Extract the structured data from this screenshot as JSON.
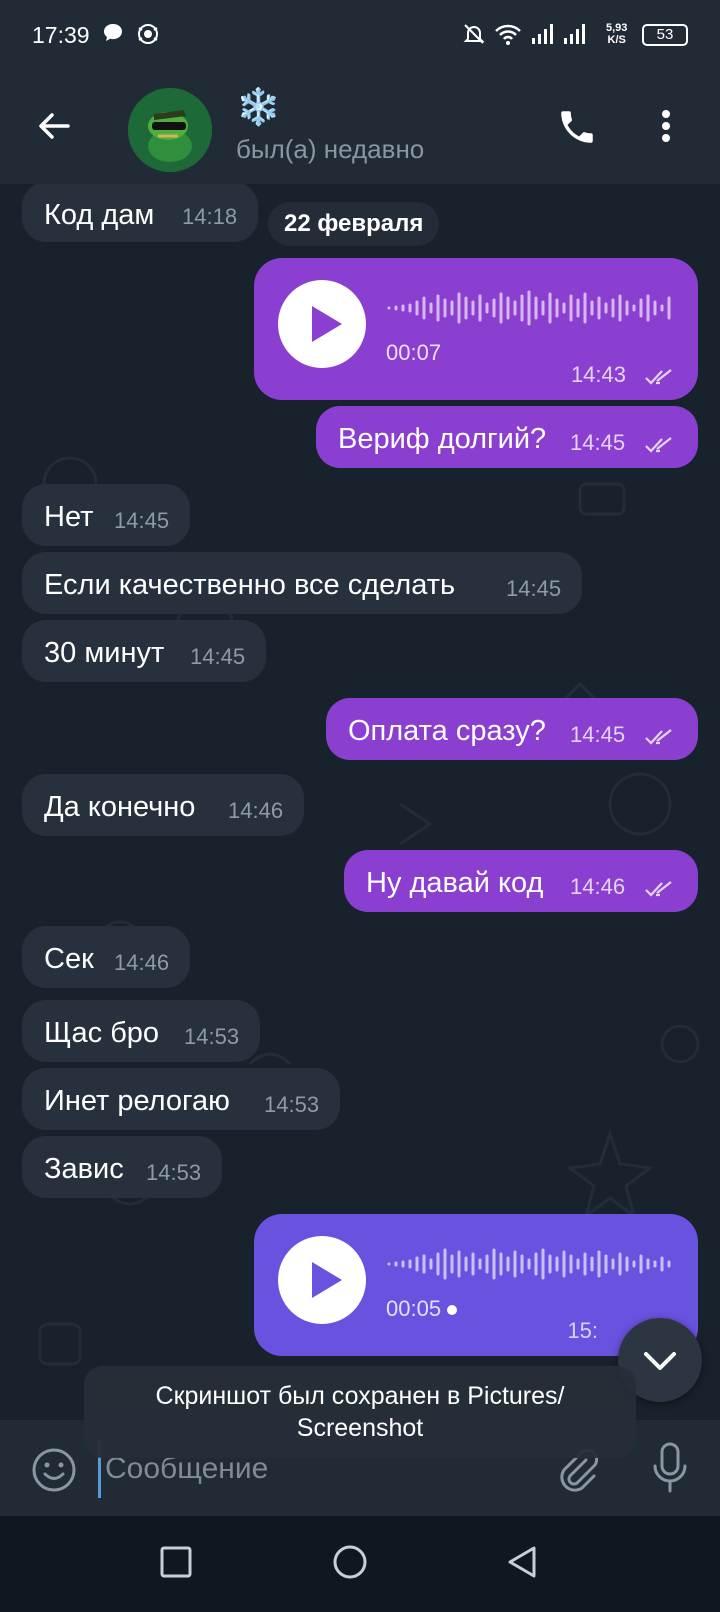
{
  "status_bar": {
    "time": "17:39",
    "net_speed_top": "5,93",
    "net_speed_bottom": "K/S",
    "battery": "53"
  },
  "header": {
    "name": "❄️",
    "status": "был(а) недавно",
    "icons": [
      "back-arrow-icon",
      "avatar",
      "phone-icon",
      "more-vertical-icon"
    ]
  },
  "chat": {
    "date_separator": "22 февраля",
    "messages": [
      {
        "dir": "in",
        "text": "Код дам",
        "time": "14:18"
      },
      {
        "dir": "out",
        "type": "voice",
        "duration": "00:07",
        "time": "14:43"
      },
      {
        "dir": "out",
        "text": "Вериф долгий?",
        "time": "14:45"
      },
      {
        "dir": "in",
        "text": "Нет",
        "time": "14:45"
      },
      {
        "dir": "in",
        "text": "Если качественно все сделать",
        "time": "14:45"
      },
      {
        "dir": "in",
        "text": "30 минут",
        "time": "14:45"
      },
      {
        "dir": "out",
        "text": "Оплата сразу?",
        "time": "14:45"
      },
      {
        "dir": "in",
        "text": "Да конечно",
        "time": "14:46"
      },
      {
        "dir": "out",
        "text": "Ну давай код",
        "time": "14:46"
      },
      {
        "dir": "in",
        "text": "Сек",
        "time": "14:46"
      },
      {
        "dir": "in",
        "text": "Щас бро",
        "time": "14:53"
      },
      {
        "dir": "in",
        "text": "Инет релогаю",
        "time": "14:53"
      },
      {
        "dir": "in",
        "text": "Завис",
        "time": "14:53"
      },
      {
        "dir": "out",
        "type": "voice",
        "duration": "00:05",
        "time": "15:"
      }
    ]
  },
  "toast": {
    "line1": "Скриншот был сохранен в  Pictures/",
    "line2": "Screenshot"
  },
  "input": {
    "placeholder": "Сообщение"
  },
  "colors": {
    "outgoing_bubble": "#8b3fd0",
    "outgoing_bubble_voice2": "#6a52e0",
    "incoming_bubble": "#27313d",
    "background": "#18222d",
    "bar": "#212b36"
  }
}
